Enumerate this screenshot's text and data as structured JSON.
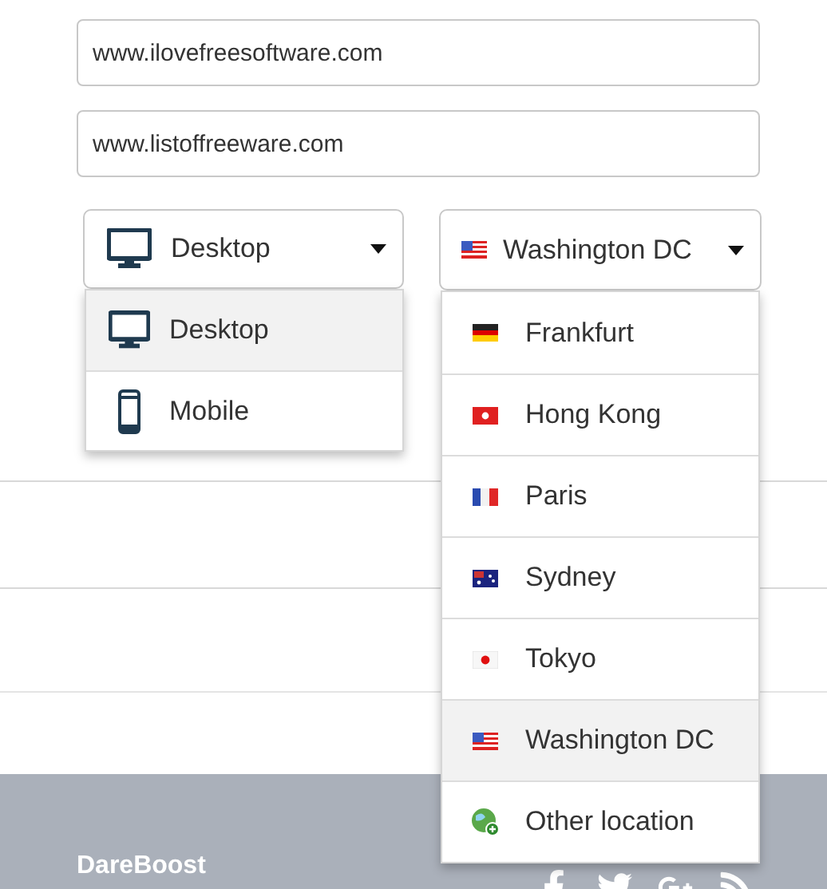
{
  "url_fields": [
    {
      "value": "www.ilovefreesoftware.com"
    },
    {
      "value": "www.listoffreeware.com"
    }
  ],
  "device_select": {
    "value": "Desktop",
    "kind": "desktop",
    "expanded": true,
    "options": [
      {
        "label": "Desktop",
        "kind": "desktop",
        "selected": true
      },
      {
        "label": "Mobile",
        "kind": "mobile",
        "selected": false
      }
    ]
  },
  "location_select": {
    "value": "Washington DC",
    "kind": "usa",
    "expanded": true,
    "options": [
      {
        "label": "Frankfurt",
        "kind": "germany",
        "selected": false
      },
      {
        "label": "Hong Kong",
        "kind": "hongkong",
        "selected": false
      },
      {
        "label": "Paris",
        "kind": "france",
        "selected": false
      },
      {
        "label": "Sydney",
        "kind": "australia",
        "selected": false
      },
      {
        "label": "Tokyo",
        "kind": "japan",
        "selected": false
      },
      {
        "label": "Washington DC",
        "kind": "usa",
        "selected": true
      },
      {
        "label": "Other location",
        "kind": "globe",
        "selected": false
      }
    ]
  },
  "footer": {
    "brand": "DareBoost"
  }
}
